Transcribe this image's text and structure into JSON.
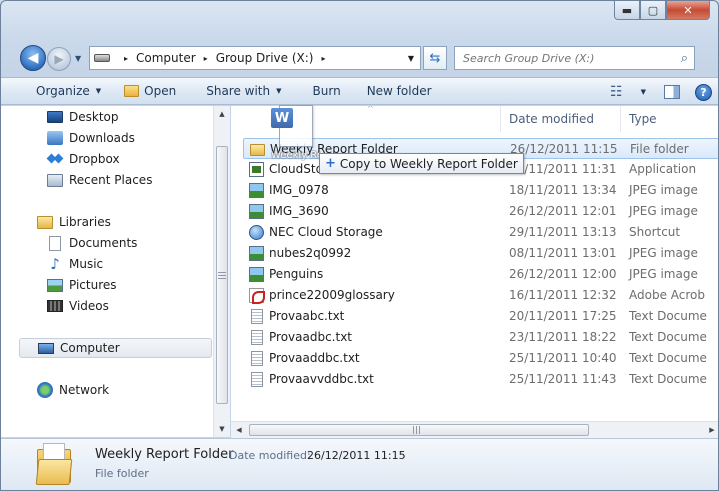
{
  "window": {
    "caption": {
      "minimize": "▬",
      "maximize": "▢",
      "close": "✕"
    }
  },
  "nav": {
    "back": "◀",
    "forward": "▶",
    "history_dropdown": "▼"
  },
  "address": {
    "breadcrumbs": [
      "Computer",
      "Group Drive (X:)"
    ],
    "separator": "▸",
    "dropdown": "▼"
  },
  "refresh_label": "⇆",
  "search": {
    "placeholder": "Search Group Drive (X:)",
    "icon": "⌕"
  },
  "toolbar": {
    "organize": "Organize",
    "open": "Open",
    "share_with": "Share with",
    "burn": "Burn",
    "new_folder": "New folder",
    "dropdown_arrow": "▼",
    "view_icon": "☷",
    "help": "?"
  },
  "navpane": {
    "favorites": [
      "Desktop",
      "Downloads",
      "Dropbox",
      "Recent Places"
    ],
    "libraries_label": "Libraries",
    "libraries": [
      "Documents",
      "Music",
      "Pictures",
      "Videos"
    ],
    "computer": "Computer",
    "network": "Network"
  },
  "columns": {
    "name": "",
    "date_modified": "Date modified",
    "type": "Type",
    "sort_indicator": "^"
  },
  "files": [
    {
      "name": "Weekly Report Folder",
      "date": "26/12/2011 11:15",
      "type": "File folder",
      "icon": "folder-icon"
    },
    {
      "name": "CloudStor",
      "date": "28/11/2011 11:31",
      "type": "Application",
      "icon": "application-icon"
    },
    {
      "name": "IMG_0978",
      "date": "18/11/2011 13:34",
      "type": "JPEG image",
      "icon": "jpeg-icon"
    },
    {
      "name": "IMG_3690",
      "date": "26/12/2011 12:01",
      "type": "JPEG image",
      "icon": "jpeg-icon"
    },
    {
      "name": "NEC Cloud Storage",
      "date": "29/11/2011 13:13",
      "type": "Shortcut",
      "icon": "shortcut-icon"
    },
    {
      "name": "nubes2q0992",
      "date": "08/11/2011 13:01",
      "type": "JPEG image",
      "icon": "jpeg-icon"
    },
    {
      "name": "Penguins",
      "date": "26/12/2011 12:00",
      "type": "JPEG image",
      "icon": "jpeg-icon"
    },
    {
      "name": "prince22009glossary",
      "date": "16/11/2011 12:32",
      "type": "Adobe Acrob",
      "icon": "pdf-icon"
    },
    {
      "name": "Provaabc.txt",
      "date": "20/11/2011 17:25",
      "type": "Text Docume",
      "icon": "text-icon"
    },
    {
      "name": "Provaadbc.txt",
      "date": "23/11/2011 18:22",
      "type": "Text Docume",
      "icon": "text-icon"
    },
    {
      "name": "Provaaddbc.txt",
      "date": "25/11/2011 10:40",
      "type": "Text Docume",
      "icon": "text-icon"
    },
    {
      "name": "Provaavvddbc.txt",
      "date": "25/11/2011 11:43",
      "type": "Text Docume",
      "icon": "text-icon"
    }
  ],
  "drag": {
    "doc_letter": "W",
    "caption": "Weekly Report",
    "tooltip_action": "Copy to Weekly Report Folder",
    "plus": "+"
  },
  "scroll": {
    "up": "▲",
    "down": "▼",
    "left": "◀",
    "right": "▶"
  },
  "details": {
    "name": "Weekly Report Folder",
    "date_label": "Date modified:",
    "date_value": "26/12/2011 11:15",
    "type": "File folder"
  }
}
